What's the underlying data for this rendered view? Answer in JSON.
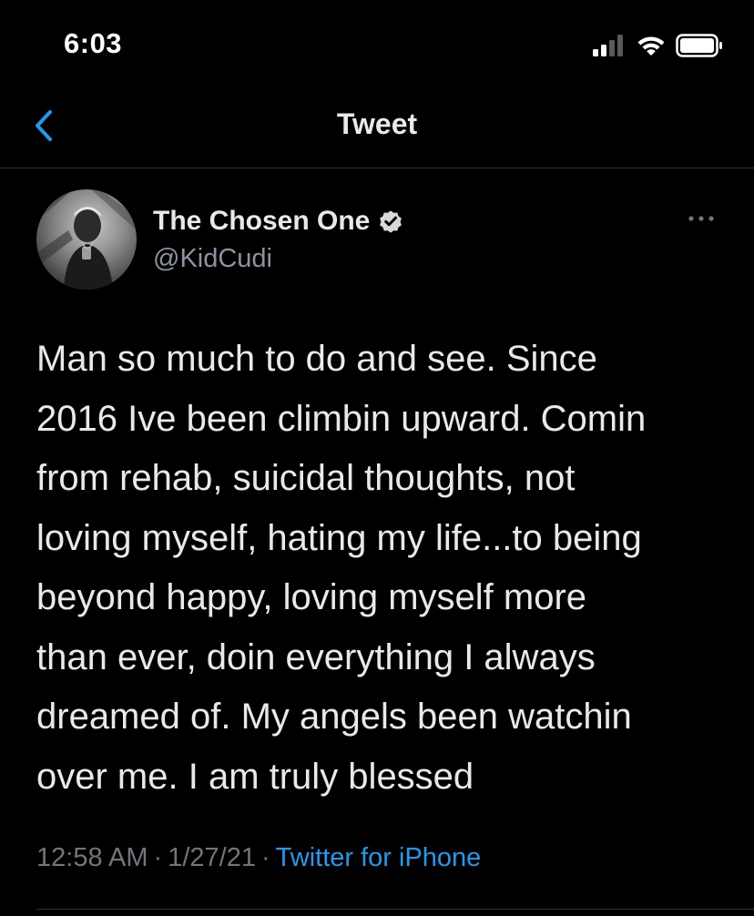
{
  "status_bar": {
    "time": "6:03",
    "icons": [
      "cellular-signal-icon",
      "wifi-icon",
      "battery-icon"
    ]
  },
  "nav": {
    "back_icon": "chevron-left-icon",
    "title": "Tweet"
  },
  "tweet": {
    "author": {
      "display_name": "The Chosen One",
      "verified": true,
      "handle": "@KidCudi"
    },
    "more_icon": "ellipsis-icon",
    "text": "Man so much to do and see.  Since\n2016 Ive been climbin upward.  Comin\nfrom rehab, suicidal thoughts, not\nloving myself, hating my life...to being\nbeyond happy, loving myself more\nthan ever, doin everything I always\ndreamed of.  My angels been watchin\nover me.  I am truly blessed",
    "time": "12:58 AM",
    "separator": "·",
    "date": "1/27/21",
    "source": "Twitter for iPhone"
  },
  "colors": {
    "background": "#000000",
    "text": "#e7e9ea",
    "muted": "#71767b",
    "accent": "#1d9bf0",
    "divider": "#2f3336"
  }
}
